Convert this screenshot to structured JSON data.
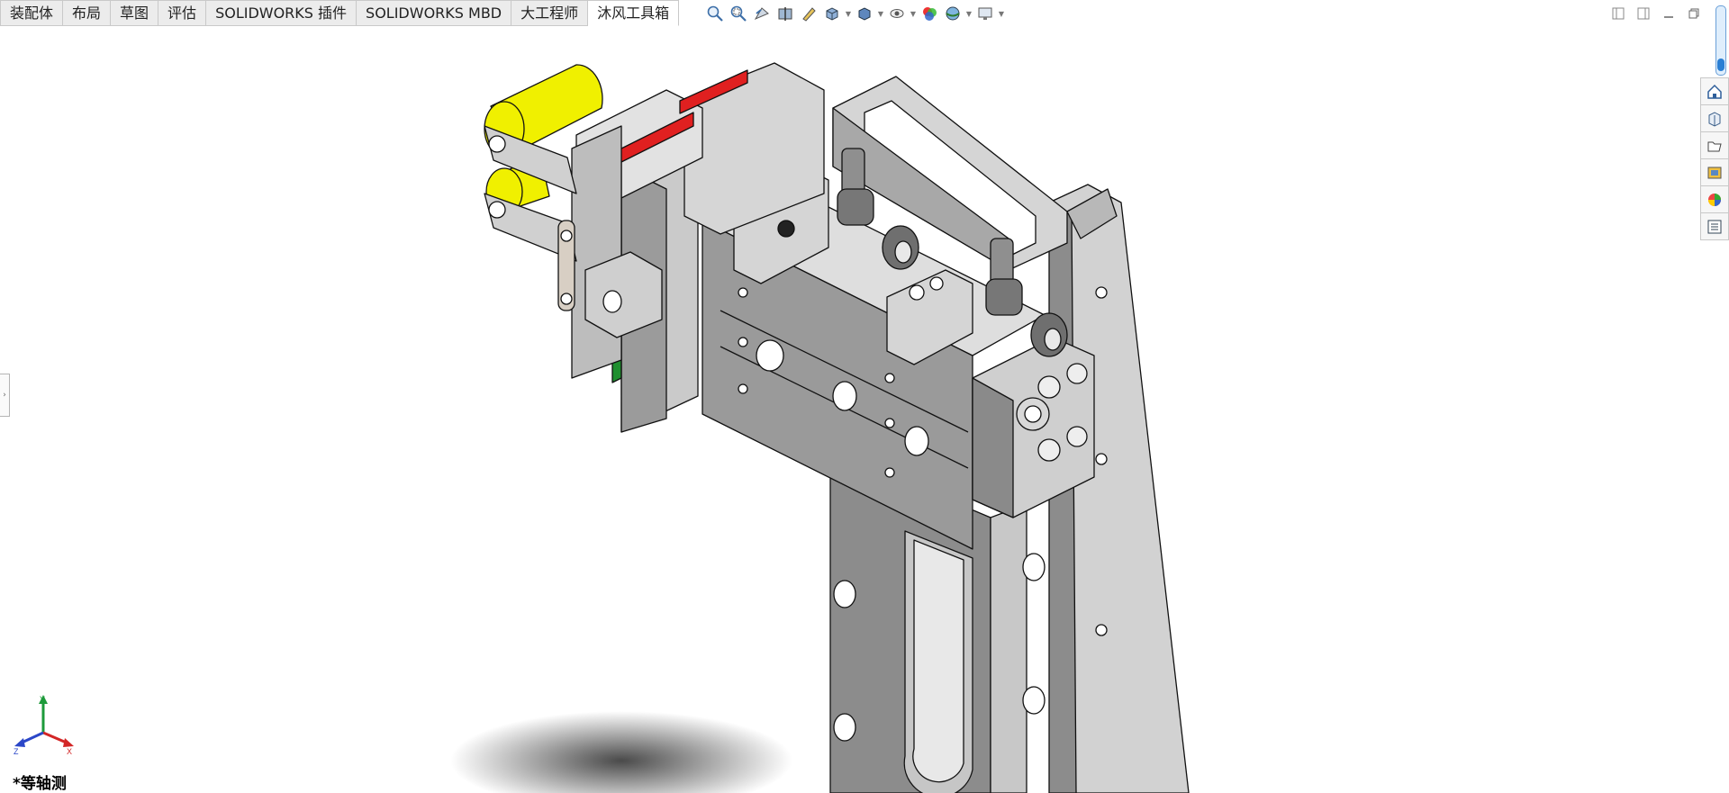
{
  "tabs": [
    {
      "label": "装配体",
      "active": false
    },
    {
      "label": "布局",
      "active": false
    },
    {
      "label": "草图",
      "active": false
    },
    {
      "label": "评估",
      "active": false
    },
    {
      "label": "SOLIDWORKS 插件",
      "active": false
    },
    {
      "label": "SOLIDWORKS MBD",
      "active": false
    },
    {
      "label": "大工程师",
      "active": false
    },
    {
      "label": "沐风工具箱",
      "active": true
    }
  ],
  "heads_up_toolbar": [
    "zoom-to-fit-icon",
    "zoom-to-area-icon",
    "previous-view-icon",
    "section-view-icon",
    "dynamic-annotation-icon",
    "view-orientation-icon",
    "display-style-icon",
    "hide-show-items-icon",
    "edit-appearance-icon",
    "apply-scene-icon",
    "view-settings-icon"
  ],
  "task_pane": [
    "solidworks-resources-icon",
    "design-library-icon",
    "file-explorer-icon",
    "view-palette-icon",
    "appearances-scenes-icon",
    "custom-properties-icon"
  ],
  "triad": {
    "x": "X",
    "y": "Y",
    "z": "Z"
  },
  "view_label": "*等轴测",
  "colors": {
    "background": "#ffffff",
    "part_gray": "#8c8c8c",
    "part_light": "#d4d4d4",
    "highlight_yellow": "#f0f000",
    "accent_red": "#e02020",
    "accent_green": "#1f8f2f"
  }
}
